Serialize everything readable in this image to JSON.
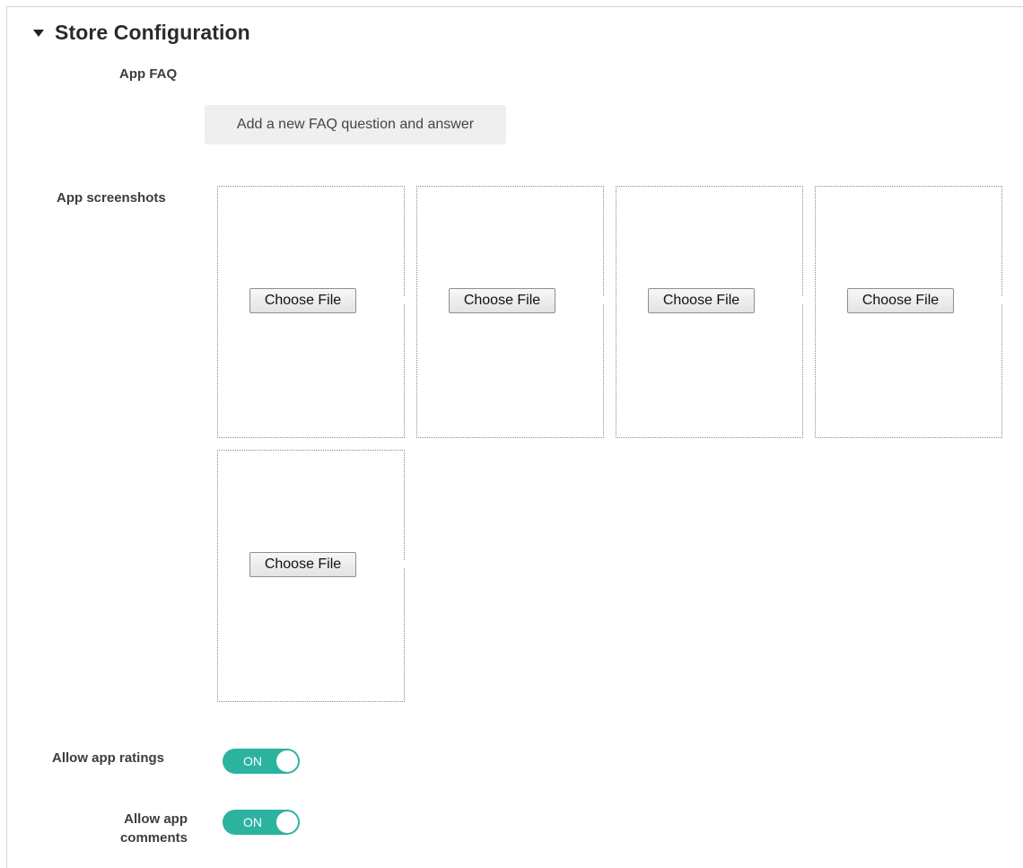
{
  "section": {
    "title": "Store Configuration",
    "expanded": true
  },
  "faq": {
    "label": "App FAQ",
    "button_label": "Add a new FAQ question and answer"
  },
  "screenshots": {
    "label": "App screenshots",
    "slots": [
      {
        "button_label": "Choose File"
      },
      {
        "button_label": "Choose File"
      },
      {
        "button_label": "Choose File"
      },
      {
        "button_label": "Choose File"
      },
      {
        "button_label": "Choose File"
      }
    ]
  },
  "ratings": {
    "label": "Allow app ratings",
    "state": "ON",
    "on": true
  },
  "comments": {
    "label_line1": "Allow app",
    "label_line2": "comments",
    "state": "ON",
    "on": true
  },
  "colors": {
    "toggle_on": "#2bb3a0",
    "button_gray": "#efefef"
  }
}
